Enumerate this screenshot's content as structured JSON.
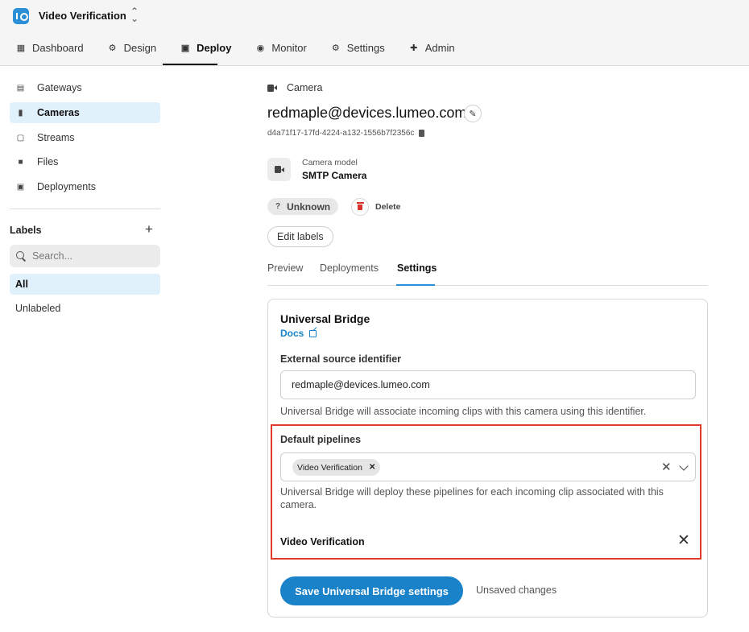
{
  "app": {
    "title": "Video Verification"
  },
  "nav": {
    "items": [
      {
        "label": "Dashboard",
        "icon": "dashboard-icon"
      },
      {
        "label": "Design",
        "icon": "design-icon"
      },
      {
        "label": "Deploy",
        "icon": "deploy-icon",
        "active": true
      },
      {
        "label": "Monitor",
        "icon": "monitor-icon"
      },
      {
        "label": "Settings",
        "icon": "gear-icon"
      },
      {
        "label": "Admin",
        "icon": "admin-icon"
      }
    ]
  },
  "sidebar": {
    "items": [
      {
        "label": "Gateways",
        "icon": "gateway-icon"
      },
      {
        "label": "Cameras",
        "icon": "camera-icon",
        "active": true
      },
      {
        "label": "Streams",
        "icon": "cast-icon"
      },
      {
        "label": "Files",
        "icon": "file-icon"
      },
      {
        "label": "Deployments",
        "icon": "deployment-icon"
      }
    ],
    "labels_heading": "Labels",
    "search_placeholder": "Search...",
    "filters": [
      {
        "label": "All",
        "active": true
      },
      {
        "label": "Unlabeled"
      }
    ]
  },
  "camera": {
    "breadcrumb": "Camera",
    "title": "redmaple@devices.lumeo.com",
    "id": "d4a71f17-17fd-4224-a132-1556b7f2356c",
    "model_label": "Camera model",
    "model_value": "SMTP Camera",
    "status": "Unknown",
    "delete_label": "Delete",
    "edit_labels": "Edit labels"
  },
  "tabs": [
    {
      "label": "Preview"
    },
    {
      "label": "Deployments"
    },
    {
      "label": "Settings",
      "active": true
    }
  ],
  "bridge": {
    "title": "Universal Bridge",
    "docs_label": "Docs",
    "source_label": "External source identifier",
    "source_value": "redmaple@devices.lumeo.com",
    "source_hint": "Universal Bridge will associate incoming clips with this camera using this identifier.",
    "pipelines_label": "Default pipelines",
    "selected_chip": "Video Verification",
    "pipelines_hint": "Universal Bridge will deploy these pipelines for each incoming clip associated with this camera.",
    "pipeline_item": "Video Verification",
    "save_label": "Save Universal Bridge settings",
    "unsaved_label": "Unsaved changes"
  },
  "colors": {
    "accent": "#1a82c8",
    "highlight": "#e23a2a",
    "active_bg": "#e1f1fb"
  }
}
